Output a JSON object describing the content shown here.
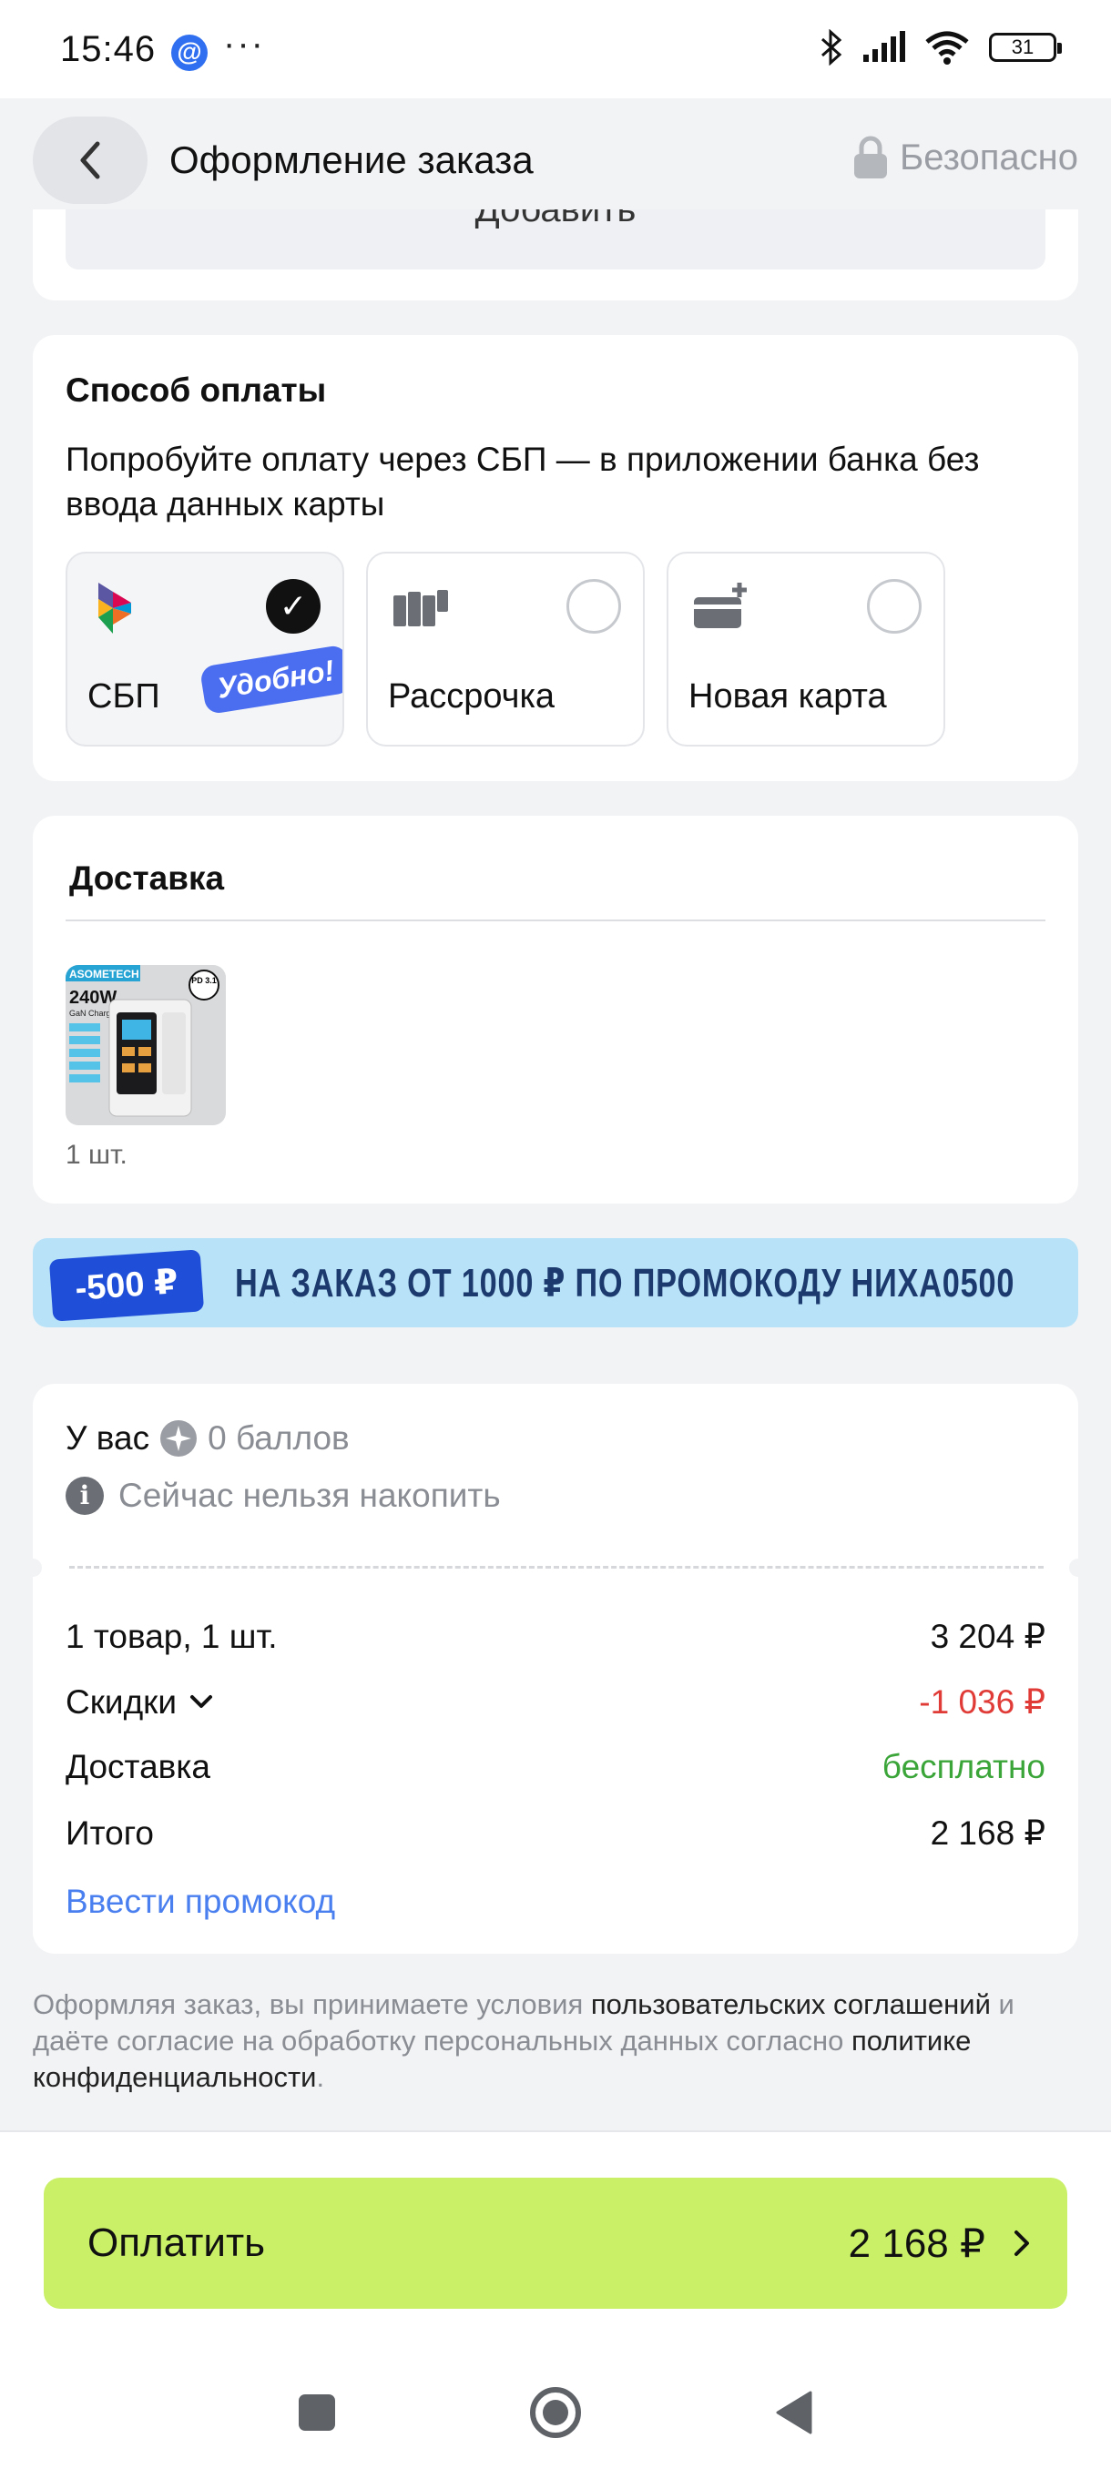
{
  "status_bar": {
    "time": "15:46",
    "at_glyph": "@",
    "overflow": "···",
    "battery": "31"
  },
  "header": {
    "title": "Оформление заказа",
    "secure_label": "Безопасно"
  },
  "top_card": {
    "hidden_button_label": "Добавить"
  },
  "payment": {
    "heading": "Способ оплаты",
    "hint": "Попробуйте оплату через СБП — в приложении банка без ввода данных карты",
    "options": [
      {
        "label": "СБП",
        "selected": true,
        "badge": "Удобно!",
        "icon": "sbp-logo-icon"
      },
      {
        "label": "Рассрочка",
        "selected": false,
        "icon": "installment-icon"
      },
      {
        "label": "Новая карта",
        "selected": false,
        "icon": "new-card-icon"
      }
    ],
    "check_glyph": "✓"
  },
  "delivery": {
    "heading": "Доставка",
    "product": {
      "brand": "ASOMETECH",
      "power": "240W",
      "subtitle": "GaN Charger",
      "pd": "PD 3.1",
      "quantity": "1 шт."
    }
  },
  "promo_banner": {
    "amount": "-500 ₽",
    "text": "НА ЗАКАЗ ОТ 1000 ₽ ПО ПРОМОКОДУ НИХА0500",
    "bg_color": "#b8e2f8"
  },
  "summary": {
    "bonus_label": "У вас",
    "bonus_value": "0 баллов",
    "notice": "Сейчас нельзя накопить",
    "info_glyph": "i",
    "rows": [
      {
        "label": "1 товар, 1 шт.",
        "value": "3 204 ₽"
      },
      {
        "label": "Скидки",
        "value": "-1 036 ₽"
      },
      {
        "label": "Доставка",
        "value": "бесплатно"
      },
      {
        "label": "Итого",
        "value": "2 168 ₽"
      }
    ],
    "promo_link": "Ввести промокод",
    "colors": {
      "discount": "#e03b36",
      "free": "#3ba53a",
      "link": "#4a7ff0"
    }
  },
  "legal": {
    "part1": "Оформляя заказ, вы принимаете условия ",
    "link1": "пользовательских соглашений",
    "part2": " и даёте согласие на обработку персональных данных согласно ",
    "link2": "политике конфиденциальности",
    "part3": "."
  },
  "pay_button": {
    "label": "Оплатить",
    "amount": "2 168 ₽",
    "color": "#c9f066"
  }
}
